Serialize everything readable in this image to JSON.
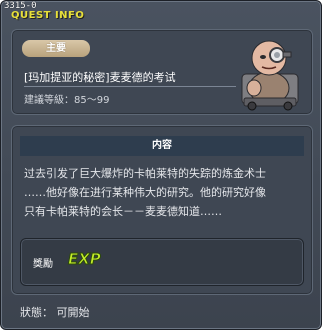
{
  "window": {
    "quest_id": "3315-0",
    "title": "QUEST INFO"
  },
  "header": {
    "badge": "主要",
    "quest_name": "[玛加提亚的秘密]麦麦德的考试",
    "level": "建議等級：85～99",
    "npc_icon": "old-scientist-npc-portrait"
  },
  "content": {
    "header": "内容",
    "description": "过去引发了巨大爆炸的卡帕莱特的失踪的炼金术士\n……他好像在进行某种伟大的研究。他的研究好像\n只有卡帕莱特的会长－－麦麦德知道……"
  },
  "reward": {
    "label": "獎勵",
    "exp_text": "EXP"
  },
  "status": {
    "text": "狀態：  可開始"
  },
  "colors": {
    "title": "#e8e03a",
    "badge": "#c8b28d",
    "exp": "#c4ee2a"
  }
}
